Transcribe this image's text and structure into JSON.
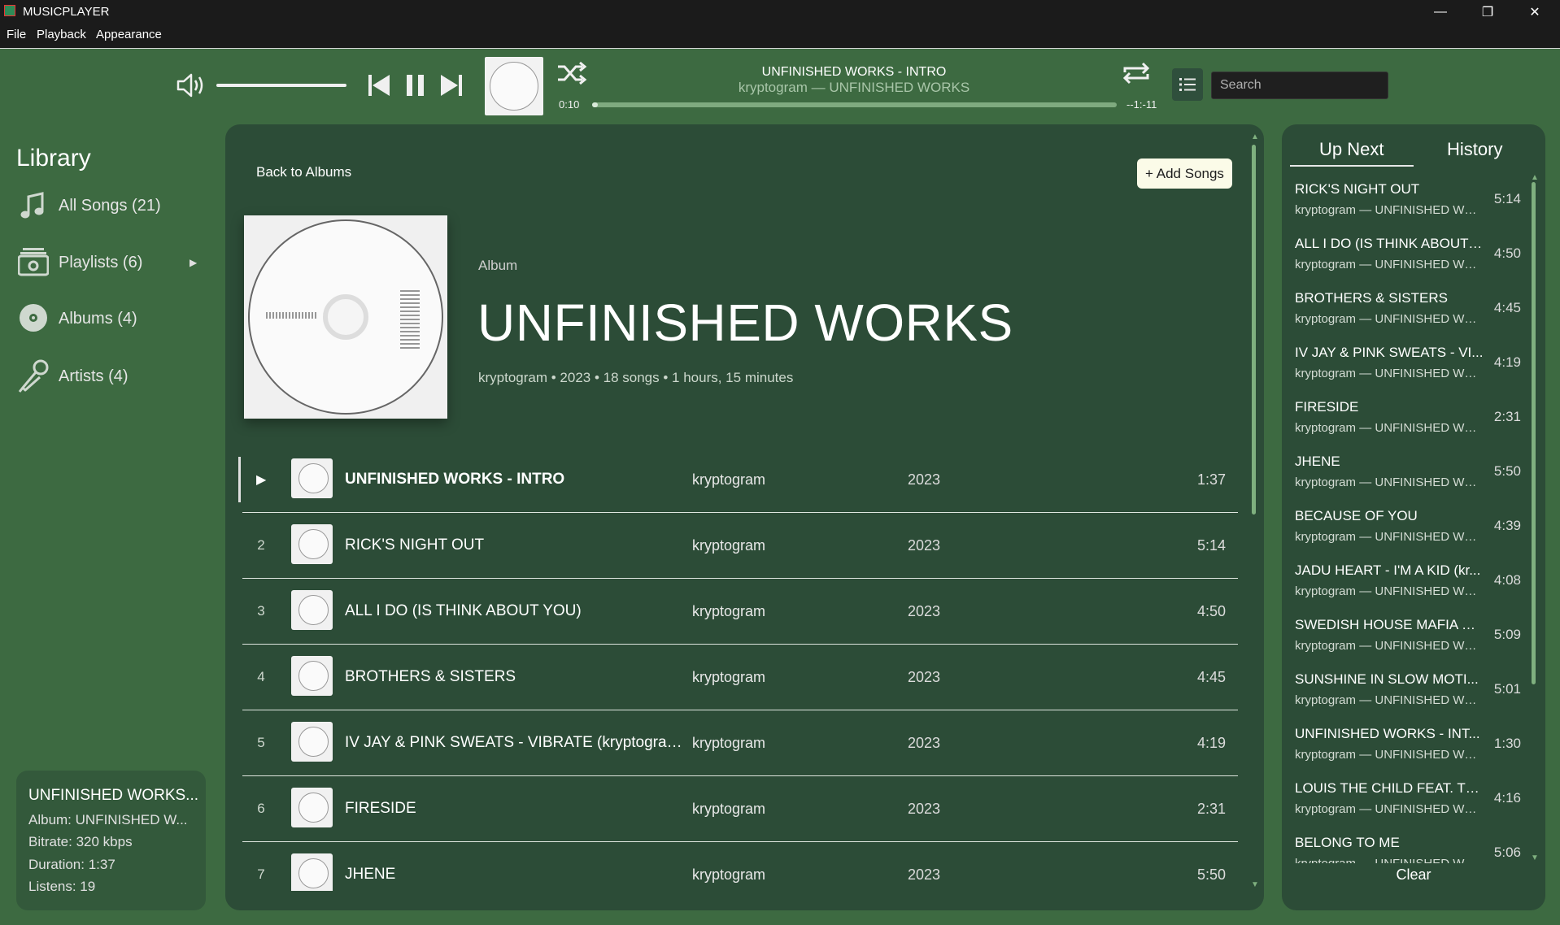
{
  "window": {
    "title": "MUSICPLAYER",
    "controls": {
      "minimize": "—",
      "maximize": "❐",
      "close": "✕"
    }
  },
  "menu": [
    "File",
    "Playback",
    "Appearance"
  ],
  "player": {
    "title": "UNFINISHED WORKS - INTRO",
    "subtitle": "kryptogram — UNFINISHED WORKS",
    "elapsed": "0:10",
    "remaining": "--1:-11",
    "volume_level": 1.0,
    "progress_fraction": 0.01,
    "search_placeholder": "Search"
  },
  "library": {
    "title": "Library",
    "items": [
      {
        "label": "All Songs (21)",
        "icon": "music-note-icon"
      },
      {
        "label": "Playlists (6)",
        "icon": "playlist-icon",
        "expand": "▶"
      },
      {
        "label": "Albums (4)",
        "icon": "album-disc-icon"
      },
      {
        "label": "Artists (4)",
        "icon": "microphone-icon"
      }
    ]
  },
  "now_playing_info": {
    "title": "UNFINISHED WORKS...",
    "album": "Album: UNFINISHED W...",
    "bitrate": "Bitrate: 320 kbps",
    "duration": "Duration: 1:37",
    "listens": "Listens: 19"
  },
  "album_view": {
    "back_label": "Back to Albums",
    "add_label": "+ Add Songs",
    "kicker": "Album",
    "name": "UNFINISHED WORKS",
    "meta": "kryptogram • 2023 • 18 songs • 1 hours, 15 minutes",
    "play_glyph": "▶",
    "tracks": [
      {
        "num": "",
        "title": "UNFINISHED WORKS - INTRO",
        "artist": "kryptogram",
        "year": "2023",
        "duration": "1:37",
        "playing": true
      },
      {
        "num": "2",
        "title": "RICK'S NIGHT OUT",
        "artist": "kryptogram",
        "year": "2023",
        "duration": "5:14"
      },
      {
        "num": "3",
        "title": "ALL I DO (IS THINK ABOUT YOU)",
        "artist": "kryptogram",
        "year": "2023",
        "duration": "4:50"
      },
      {
        "num": "4",
        "title": "BROTHERS & SISTERS",
        "artist": "kryptogram",
        "year": "2023",
        "duration": "4:45"
      },
      {
        "num": "5",
        "title": "IV JAY & PINK SWEATS - VIBRATE (kryptogram ...",
        "artist": "kryptogram",
        "year": "2023",
        "duration": "4:19"
      },
      {
        "num": "6",
        "title": "FIRESIDE",
        "artist": "kryptogram",
        "year": "2023",
        "duration": "2:31"
      },
      {
        "num": "7",
        "title": "JHENE",
        "artist": "kryptogram",
        "year": "2023",
        "duration": "5:50"
      }
    ]
  },
  "queue": {
    "tabs": [
      "Up Next",
      "History"
    ],
    "clear_label": "Clear",
    "items": [
      {
        "title": "RICK'S NIGHT OUT",
        "sub": "kryptogram — UNFINISHED WO...",
        "duration": "5:14"
      },
      {
        "title": "ALL I DO (IS THINK ABOUT ...",
        "sub": "kryptogram — UNFINISHED WO...",
        "duration": "4:50"
      },
      {
        "title": "BROTHERS & SISTERS",
        "sub": "kryptogram — UNFINISHED WO...",
        "duration": "4:45"
      },
      {
        "title": "IV JAY & PINK SWEATS - VI...",
        "sub": "kryptogram — UNFINISHED WO...",
        "duration": "4:19"
      },
      {
        "title": "FIRESIDE",
        "sub": "kryptogram — UNFINISHED WO...",
        "duration": "2:31"
      },
      {
        "title": "JHENE",
        "sub": "kryptogram — UNFINISHED WO...",
        "duration": "5:50"
      },
      {
        "title": "BECAUSE OF YOU",
        "sub": "kryptogram — UNFINISHED WO...",
        "duration": "4:39"
      },
      {
        "title": "JADU HEART - I'M A KID (kr...",
        "sub": "kryptogram — UNFINISHED WO...",
        "duration": "4:08"
      },
      {
        "title": "SWEDISH HOUSE MAFIA & ...",
        "sub": "kryptogram — UNFINISHED WO...",
        "duration": "5:09"
      },
      {
        "title": "SUNSHINE IN SLOW MOTI...",
        "sub": "kryptogram — UNFINISHED WO...",
        "duration": "5:01"
      },
      {
        "title": "UNFINISHED WORKS - INT...",
        "sub": "kryptogram — UNFINISHED WO...",
        "duration": "1:30"
      },
      {
        "title": "LOUIS THE CHILD FEAT. TH...",
        "sub": "kryptogram — UNFINISHED WO...",
        "duration": "4:16"
      },
      {
        "title": "BELONG TO ME",
        "sub": "kryptogram — UNFINISHED WO...",
        "duration": "5:06"
      }
    ]
  },
  "colors": {
    "background": "#3d6a41",
    "panel": "#2c4c37",
    "accent": "#7fb07f",
    "titlebar": "#1b1b1b"
  }
}
